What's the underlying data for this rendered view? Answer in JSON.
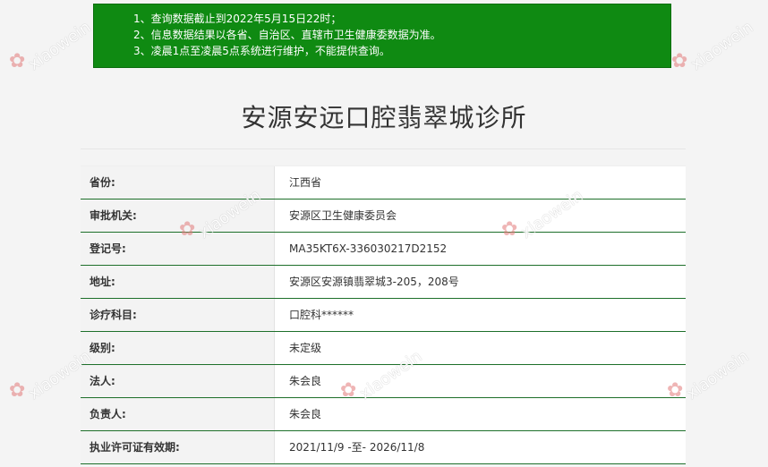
{
  "notice": {
    "lines": [
      "1、查询数据截止到2022年5月15日22时；",
      "2、信息数据结果以各省、自治区、直辖市卫生健康委数据为准。",
      "3、凌晨1点至凌晨5点系统进行维护，不能提供查询。"
    ]
  },
  "clinic": {
    "title": "安源安远口腔翡翠城诊所"
  },
  "details": [
    {
      "label": "省份:",
      "value": "江西省"
    },
    {
      "label": "审批机关:",
      "value": "安源区卫生健康委员会"
    },
    {
      "label": "登记号:",
      "value": "MA35KT6X-336030217D2152"
    },
    {
      "label": "地址:",
      "value": "安源区安源镇翡翠城3-205，208号"
    },
    {
      "label": "诊疗科目:",
      "value": "口腔科******"
    },
    {
      "label": "级别:",
      "value": "未定级"
    },
    {
      "label": "法人:",
      "value": "朱会良"
    },
    {
      "label": "负责人:",
      "value": "朱会良"
    },
    {
      "label": "执业许可证有效期:",
      "value": "2021/11/9 -至- 2026/11/8"
    }
  ],
  "watermark": {
    "text": "xiaowein",
    "color": "#e27a7a"
  }
}
